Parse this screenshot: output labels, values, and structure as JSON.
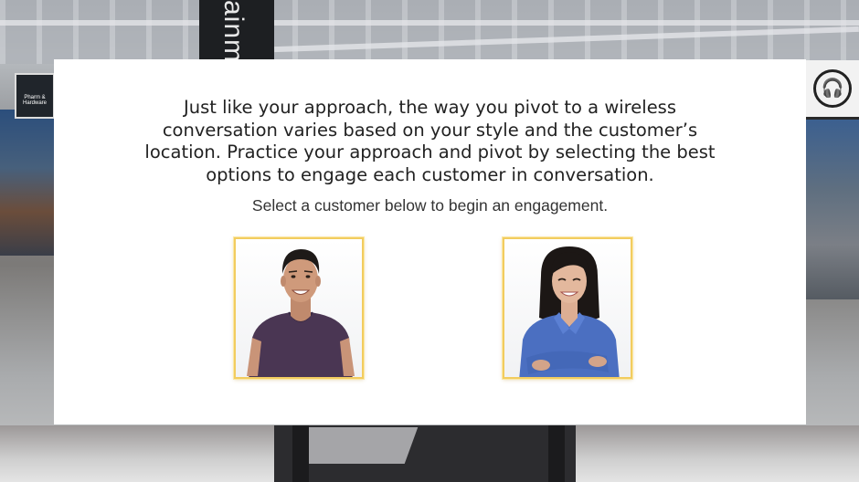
{
  "intro_lines": [
    "Just like your approach, the way you pivot to a wireless",
    "conversation varies based on your style and the customer’s",
    "location. Practice your approach and pivot by selecting the best",
    "options to engage each customer in conversation."
  ],
  "subtitle": "Select a customer below to begin an engagement.",
  "background": {
    "sign_text": "ainm",
    "store_sign_text": "Pharm & Hardware",
    "headphone_icon": "headphones-icon"
  },
  "customers": [
    {
      "icon": "young-man-portrait",
      "shirt_color": "#4a3653"
    },
    {
      "icon": "woman-portrait",
      "shirt_color": "#4b6fc1"
    }
  ],
  "colors": {
    "card": "#ffffff",
    "card_frame": "#f2cc5f"
  }
}
